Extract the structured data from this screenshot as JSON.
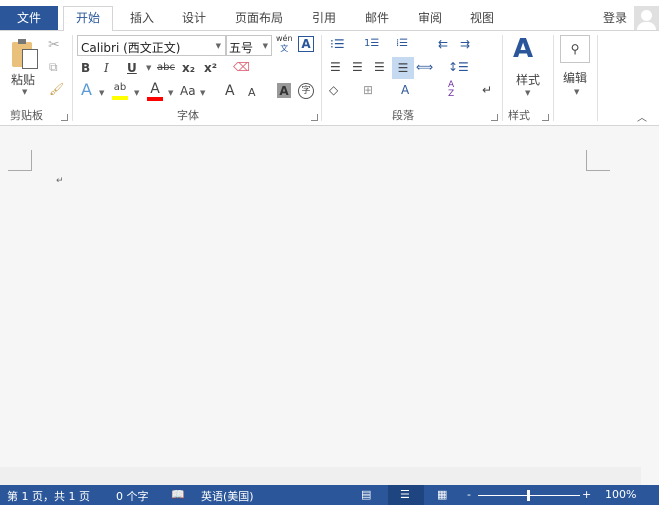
{
  "tabs": {
    "file": "文件",
    "items": [
      "开始",
      "插入",
      "设计",
      "页面布局",
      "引用",
      "邮件",
      "审阅",
      "视图"
    ],
    "active": "开始",
    "signin": "登录"
  },
  "clipboard": {
    "paste": "粘贴",
    "label": "剪贴板"
  },
  "font": {
    "name": "Calibri (西文正文)",
    "size": "五号",
    "label": "字体",
    "bold": "B",
    "italic": "I",
    "underline": "U",
    "strike": "abc",
    "sub": "x₂",
    "sup": "x²",
    "phonetic": "wén",
    "border_char": "A",
    "effects": "A",
    "highlight": "ab",
    "font_color": "A",
    "case": "Aa",
    "grow": "A",
    "shrink": "A",
    "shade": "A",
    "enclose": "字",
    "highlight_color": "#ffff00",
    "font_color_value": "#ff0000"
  },
  "paragraph": {
    "label": "段落"
  },
  "styles": {
    "button": "样式",
    "label": "样式"
  },
  "editing": {
    "button": "编辑"
  },
  "document": {
    "paragraph_mark": "↵"
  },
  "status": {
    "page": "第 1 页，共 1 页",
    "words": "0 个字",
    "language": "英语(美国)",
    "zoom": "100%",
    "zoom_minus": "-",
    "zoom_plus": "+"
  },
  "colors": {
    "accent": "#2b579a"
  }
}
